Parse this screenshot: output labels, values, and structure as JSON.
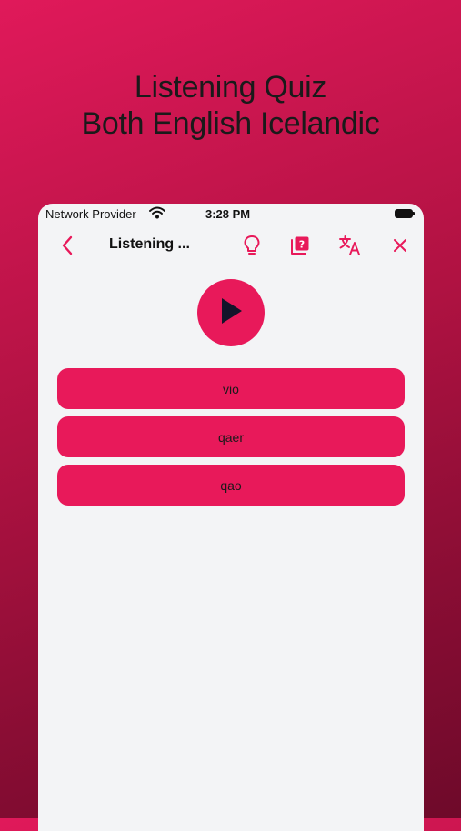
{
  "headline": {
    "line1": "Listening Quiz",
    "line2": "Both English Icelandic"
  },
  "status_bar": {
    "carrier": "Network Provider",
    "time": "3:28 PM"
  },
  "nav": {
    "title": "Listening ...",
    "icons": [
      "back-chevron-icon",
      "lightbulb-icon",
      "flashcard-question-icon",
      "translate-icon",
      "close-icon"
    ]
  },
  "quiz": {
    "answers": [
      "vio",
      "qaer",
      "qao"
    ]
  },
  "colors": {
    "accent": "#e8195a",
    "background": "#b01242",
    "screen": "#f3f4f6"
  }
}
